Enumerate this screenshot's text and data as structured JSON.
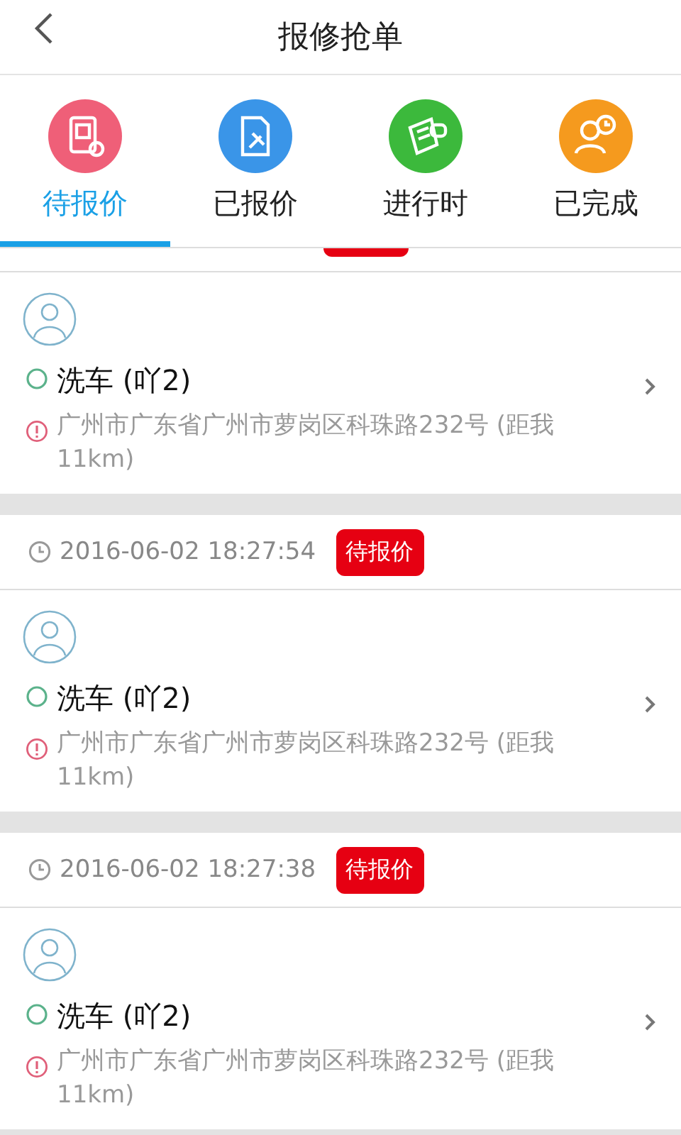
{
  "header": {
    "title": "报修抢单"
  },
  "tabs": [
    {
      "label": "待报价",
      "selected": true,
      "color": "#ef5f78"
    },
    {
      "label": "已报价",
      "selected": false,
      "color": "#3a95e8"
    },
    {
      "label": "进行时",
      "selected": false,
      "color": "#3cb93c"
    },
    {
      "label": "已完成",
      "selected": false,
      "color": "#f59a1e"
    }
  ],
  "orders": [
    {
      "kind": "cut",
      "service": "洗车 (吖2)",
      "address": "广州市广东省广州市萝岗区科珠路232号 (距我 11km)"
    },
    {
      "kind": "full",
      "time": "2016-06-02 18:27:54",
      "status": "待报价",
      "service": "洗车 (吖2)",
      "address": "广州市广东省广州市萝岗区科珠路232号 (距我 11km)"
    },
    {
      "kind": "full",
      "time": "2016-06-02 18:27:38",
      "status": "待报价",
      "service": "洗车 (吖2)",
      "address": "广州市广东省广州市萝岗区科珠路232号 (距我 11km)"
    }
  ]
}
